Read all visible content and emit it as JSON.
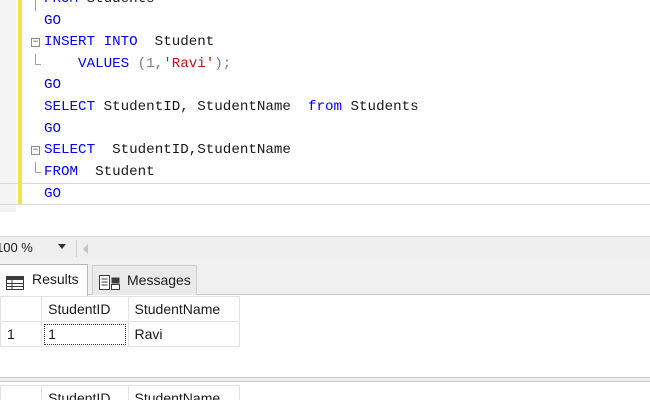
{
  "editor": {
    "lines": [
      {
        "segments": [
          {
            "text": "FROM",
            "cls": "kw"
          },
          {
            "text": " Students",
            "cls": ""
          }
        ],
        "fold": "line"
      },
      {
        "segments": [
          {
            "text": "GO",
            "cls": "kw"
          }
        ],
        "fold": "none"
      },
      {
        "segments": [
          {
            "text": "INSERT INTO",
            "cls": "kw"
          },
          {
            "text": "  Student",
            "cls": ""
          }
        ],
        "fold": "box"
      },
      {
        "segments": [
          {
            "text": "    VALUES",
            "cls": "kw"
          },
          {
            "text": " (1,",
            "cls": "gry"
          },
          {
            "text": "'Ravi'",
            "cls": "str"
          },
          {
            "text": ");",
            "cls": "gry"
          }
        ],
        "fold": "end"
      },
      {
        "segments": [
          {
            "text": "GO",
            "cls": "kw"
          }
        ],
        "fold": "none"
      },
      {
        "segments": [
          {
            "text": "SELECT",
            "cls": "kw"
          },
          {
            "text": " StudentID, StudentName  ",
            "cls": ""
          },
          {
            "text": "from",
            "cls": "kw"
          },
          {
            "text": " Students",
            "cls": ""
          }
        ],
        "fold": "none"
      },
      {
        "segments": [
          {
            "text": "GO",
            "cls": "kw"
          }
        ],
        "fold": "none"
      },
      {
        "segments": [
          {
            "text": "SELECT",
            "cls": "kw"
          },
          {
            "text": "  StudentID,StudentName",
            "cls": ""
          }
        ],
        "fold": "box"
      },
      {
        "segments": [
          {
            "text": "FROM",
            "cls": "kw"
          },
          {
            "text": "  Student",
            "cls": ""
          }
        ],
        "fold": "end"
      },
      {
        "segments": [
          {
            "text": "GO",
            "cls": "kw"
          }
        ],
        "fold": "none",
        "current": true
      }
    ]
  },
  "zoom": {
    "value": "100 %"
  },
  "results": {
    "tabs": [
      {
        "label": "Results",
        "icon": "grid-icon",
        "active": true
      },
      {
        "label": "Messages",
        "icon": "messages-icon",
        "active": false
      }
    ],
    "grid1": {
      "columns": [
        "StudentID",
        "StudentName"
      ],
      "rows": [
        {
          "num": "1",
          "cells": [
            "1",
            "Ravi"
          ]
        }
      ]
    },
    "grid2": {
      "columns": [
        "StudentID",
        "StudentName"
      ]
    }
  }
}
